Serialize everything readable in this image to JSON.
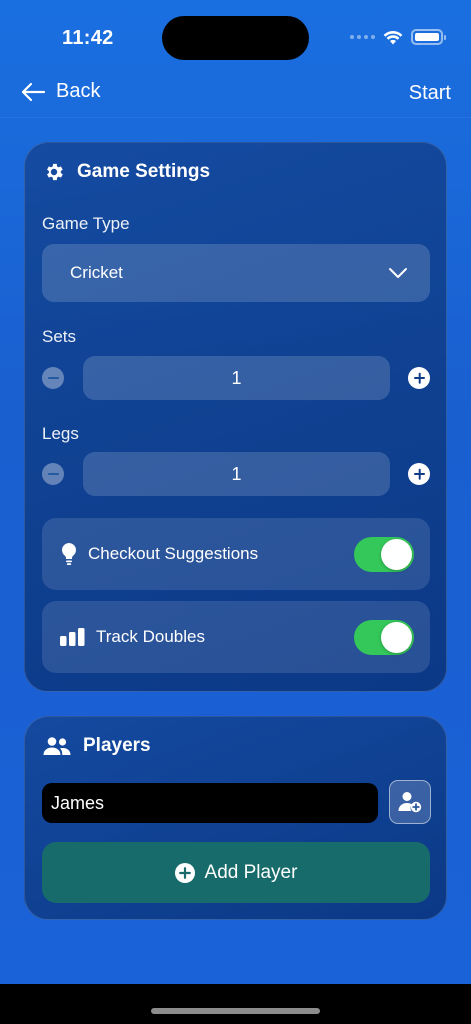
{
  "status_bar": {
    "time": "11:42"
  },
  "nav": {
    "back_label": "Back",
    "start_label": "Start"
  },
  "settings": {
    "title": "Game Settings",
    "game_type": {
      "label": "Game Type",
      "value": "Cricket"
    },
    "sets": {
      "label": "Sets",
      "value": "1"
    },
    "legs": {
      "label": "Legs",
      "value": "1"
    },
    "toggles": [
      {
        "label": "Checkout Suggestions",
        "on": true,
        "icon": "lightbulb-icon"
      },
      {
        "label": "Track Doubles",
        "on": true,
        "icon": "bar-chart-icon"
      }
    ]
  },
  "players": {
    "title": "Players",
    "name_input_value": "James",
    "add_button_label": "Add Player"
  },
  "colors": {
    "background": "#1a65d8",
    "toggle_on": "#34c759",
    "add_player_button": "#176b6a"
  }
}
